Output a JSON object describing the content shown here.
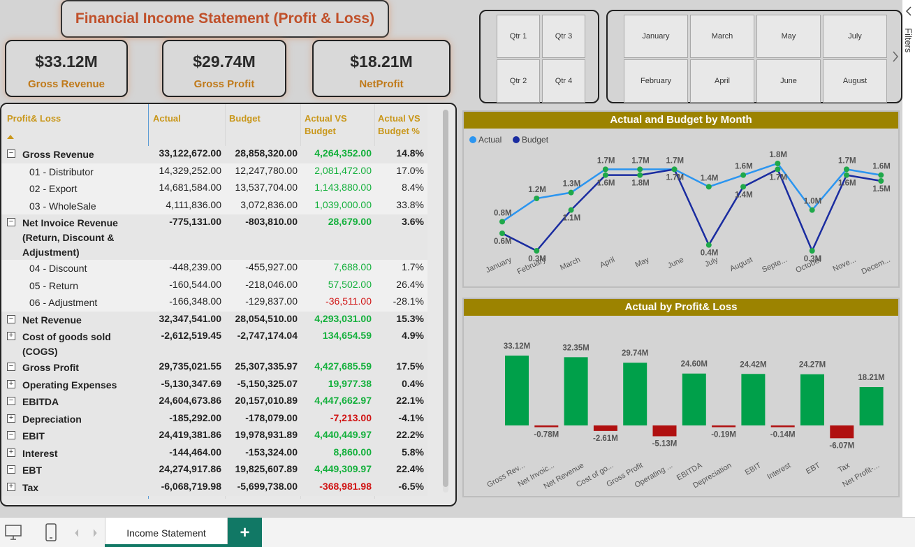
{
  "title": "Financial Income Statement (Profit & Loss)",
  "kpis": [
    {
      "value": "$33.12M",
      "label": "Gross Revenue"
    },
    {
      "value": "$29.74M",
      "label": "Gross Profit"
    },
    {
      "value": "$18.21M",
      "label": "NetProfit"
    }
  ],
  "quarter_slicer": [
    "Qtr 1",
    "Qtr 3",
    "Qtr 2",
    "Qtr 4"
  ],
  "month_slicer": [
    "January",
    "March",
    "May",
    "July",
    "February",
    "April",
    "June",
    "August"
  ],
  "table": {
    "headers": [
      "Profit& Loss",
      "Actual",
      "Budget",
      "Actual VS Budget",
      "Actual VS Budget %"
    ],
    "rows": [
      {
        "name": "Gross Revenue",
        "level": 0,
        "expand": "−",
        "actual": "33,122,672.00",
        "budget": "28,858,320.00",
        "var": "4,264,352.00",
        "pct": "14.8%",
        "sign": "pos"
      },
      {
        "name": "01 - Distributor",
        "level": 1,
        "actual": "14,329,252.00",
        "budget": "12,247,780.00",
        "var": "2,081,472.00",
        "pct": "17.0%",
        "sign": "pos"
      },
      {
        "name": "02 - Export",
        "level": 1,
        "actual": "14,681,584.00",
        "budget": "13,537,704.00",
        "var": "1,143,880.00",
        "pct": "8.4%",
        "sign": "pos"
      },
      {
        "name": "03 - WholeSale",
        "level": 1,
        "actual": "4,111,836.00",
        "budget": "3,072,836.00",
        "var": "1,039,000.00",
        "pct": "33.8%",
        "sign": "pos"
      },
      {
        "name": "Net Invoice Revenue (Return, Discount & Adjustment)",
        "level": 0,
        "expand": "−",
        "actual": "-775,131.00",
        "budget": "-803,810.00",
        "var": "28,679.00",
        "pct": "3.6%",
        "sign": "pos"
      },
      {
        "name": "04 - Discount",
        "level": 1,
        "actual": "-448,239.00",
        "budget": "-455,927.00",
        "var": "7,688.00",
        "pct": "1.7%",
        "sign": "pos"
      },
      {
        "name": "05 - Return",
        "level": 1,
        "actual": "-160,544.00",
        "budget": "-218,046.00",
        "var": "57,502.00",
        "pct": "26.4%",
        "sign": "pos"
      },
      {
        "name": "06 - Adjustment",
        "level": 1,
        "actual": "-166,348.00",
        "budget": "-129,837.00",
        "var": "-36,511.00",
        "pct": "-28.1%",
        "sign": "neg"
      },
      {
        "name": "Net Revenue",
        "level": 0,
        "expand": "−",
        "actual": "32,347,541.00",
        "budget": "28,054,510.00",
        "var": "4,293,031.00",
        "pct": "15.3%",
        "sign": "pos"
      },
      {
        "name": "Cost of goods sold (COGS)",
        "level": 0,
        "expand": "+",
        "actual": "-2,612,519.45",
        "budget": "-2,747,174.04",
        "var": "134,654.59",
        "pct": "4.9%",
        "sign": "pos"
      },
      {
        "name": "Gross Profit",
        "level": 0,
        "expand": "−",
        "actual": "29,735,021.55",
        "budget": "25,307,335.97",
        "var": "4,427,685.59",
        "pct": "17.5%",
        "sign": "pos"
      },
      {
        "name": "Operating Expenses",
        "level": 0,
        "expand": "+",
        "actual": "-5,130,347.69",
        "budget": "-5,150,325.07",
        "var": "19,977.38",
        "pct": "0.4%",
        "sign": "pos"
      },
      {
        "name": "EBITDA",
        "level": 0,
        "expand": "−",
        "actual": "24,604,673.86",
        "budget": "20,157,010.89",
        "var": "4,447,662.97",
        "pct": "22.1%",
        "sign": "pos"
      },
      {
        "name": "Depreciation",
        "level": 0,
        "expand": "+",
        "actual": "-185,292.00",
        "budget": "-178,079.00",
        "var": "-7,213.00",
        "pct": "-4.1%",
        "sign": "neg"
      },
      {
        "name": "EBIT",
        "level": 0,
        "expand": "−",
        "actual": "24,419,381.86",
        "budget": "19,978,931.89",
        "var": "4,440,449.97",
        "pct": "22.2%",
        "sign": "pos"
      },
      {
        "name": "Interest",
        "level": 0,
        "expand": "+",
        "actual": "-144,464.00",
        "budget": "-153,324.00",
        "var": "8,860.00",
        "pct": "5.8%",
        "sign": "pos"
      },
      {
        "name": "EBT",
        "level": 0,
        "expand": "−",
        "actual": "24,274,917.86",
        "budget": "19,825,607.89",
        "var": "4,449,309.97",
        "pct": "22.4%",
        "sign": "pos"
      },
      {
        "name": "Tax",
        "level": 0,
        "expand": "+",
        "actual": "-6,068,719.98",
        "budget": "-5,699,738.00",
        "var": "-368,981.98",
        "pct": "-6.5%",
        "sign": "neg"
      }
    ]
  },
  "chart_data": [
    {
      "type": "line",
      "title": "Actual and Budget by Month",
      "categories": [
        "January",
        "February",
        "March",
        "April",
        "May",
        "June",
        "July",
        "August",
        "Septe...",
        "October",
        "Nove...",
        "Decem..."
      ],
      "series": [
        {
          "name": "Actual",
          "color": "#2b95f0",
          "values": [
            0.8,
            1.2,
            1.3,
            1.7,
            1.7,
            1.7,
            1.4,
            1.6,
            1.8,
            1.0,
            1.7,
            1.6
          ]
        },
        {
          "name": "Budget",
          "color": "#1a2ca0",
          "values": [
            0.6,
            0.3,
            1.0,
            1.6,
            1.6,
            1.7,
            0.4,
            1.4,
            1.7,
            0.3,
            1.6,
            1.5
          ]
        }
      ],
      "actual_labels": [
        "0.8M",
        "1.2M",
        "1.3M",
        "1.7M",
        "1.7M",
        "1.7M",
        "1.4M",
        "1.6M",
        "1.8M",
        "1.0M",
        "1.7M",
        "1.6M"
      ],
      "budget_labels": [
        "0.6M",
        "0.3M",
        "1.1M",
        "1.6M",
        "1.8M",
        "1.7M",
        "0.4M",
        "1.4M",
        "1.7M",
        "0.3M",
        "1.6M",
        "1.5M"
      ],
      "legend": "top-left",
      "marker_color": "#1fa84a"
    },
    {
      "type": "bar",
      "title": "Actual by Profit& Loss",
      "categories": [
        "Gross Rev...",
        "Net Invoic...",
        "Net Revenue",
        "Cost of go...",
        "Gross Profit",
        "Operating ...",
        "EBITDA",
        "Depreciation",
        "EBIT",
        "Interest",
        "EBT",
        "Tax",
        "Net Profit-..."
      ],
      "values": [
        33.12,
        -0.78,
        32.35,
        -2.61,
        29.74,
        -5.13,
        24.6,
        -0.19,
        24.42,
        -0.14,
        24.27,
        -6.07,
        18.21
      ],
      "labels": [
        "33.12M",
        "-0.78M",
        "32.35M",
        "-2.61M",
        "29.74M",
        "-5.13M",
        "24.60M",
        "-0.19M",
        "24.42M",
        "-0.14M",
        "24.27M",
        "-6.07M",
        "18.21M"
      ],
      "positive_color": "#00a04a",
      "negative_color": "#b01010"
    }
  ],
  "tabs": {
    "active": "Income Statement",
    "add": "+"
  },
  "side_pane": {
    "label": "Filters"
  }
}
